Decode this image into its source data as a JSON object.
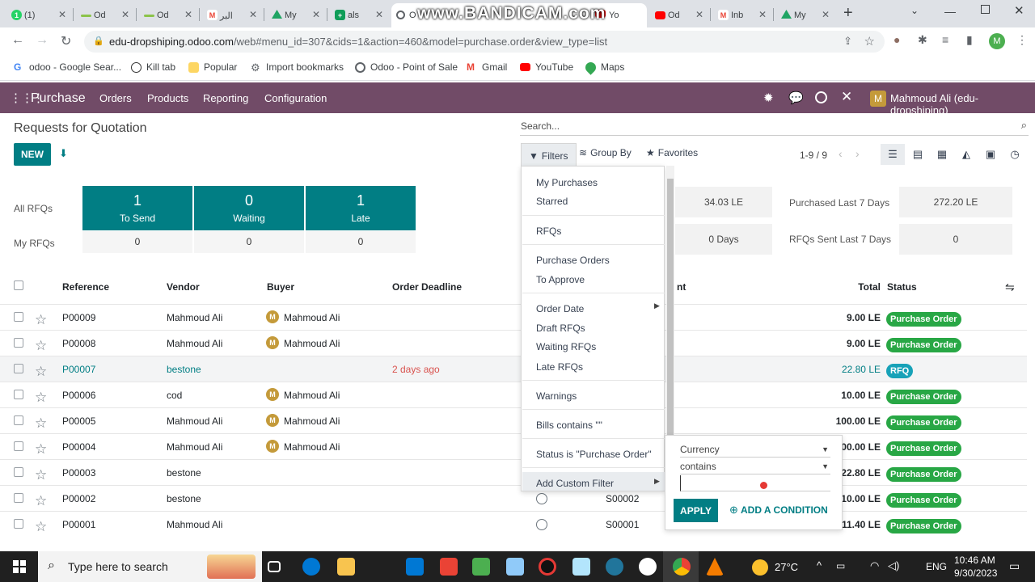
{
  "browser": {
    "tabs": [
      {
        "label": "(1)",
        "icon": "whatsapp-icon",
        "color": "#25d366"
      },
      {
        "label": "Od",
        "icon": "odoo-icon",
        "color": "#8bc34a"
      },
      {
        "label": "Od",
        "icon": "odoo-icon",
        "color": "#8bc34a"
      },
      {
        "label": "البر",
        "icon": "gmail-icon",
        "color": "#ea4335"
      },
      {
        "label": "My",
        "icon": "drive-icon",
        "color": "#1fa463"
      },
      {
        "label": "als",
        "icon": "sheets-icon",
        "color": "#0f9d58"
      },
      {
        "label": "O",
        "icon": "odoo-circle-icon",
        "color": "#5f6368"
      },
      {
        "label": "Yo",
        "icon": "youtube-icon",
        "color": "#ff0000"
      },
      {
        "label": "Od",
        "icon": "youtube-icon",
        "color": "#ff0000"
      },
      {
        "label": "Inb",
        "icon": "gmail-icon",
        "color": "#ea4335"
      },
      {
        "label": "My",
        "icon": "drive-icon",
        "color": "#1fa463"
      }
    ],
    "url_host": "edu-dropshiping.odoo.com",
    "url_path": "/web#menu_id=307&cids=1&action=460&model=purchase.order&view_type=list",
    "profile_initial": "M",
    "bookmarks": [
      {
        "label": "odoo - Google Sear...",
        "icon": "google-icon"
      },
      {
        "label": "Kill tab",
        "icon": "kill-tab-icon"
      },
      {
        "label": "Popular",
        "icon": "folder-icon"
      },
      {
        "label": "Import bookmarks",
        "icon": "gear-icon"
      },
      {
        "label": "Odoo - Point of Sale",
        "icon": "odoo-circle-icon"
      },
      {
        "label": "Gmail",
        "icon": "gmail-icon"
      },
      {
        "label": "YouTube",
        "icon": "youtube-icon"
      },
      {
        "label": "Maps",
        "icon": "maps-icon"
      }
    ]
  },
  "watermark": "www.BANDICAM.com",
  "app": {
    "name": "Purchase",
    "menu": [
      "Orders",
      "Products",
      "Reporting",
      "Configuration"
    ],
    "user": "Mahmoud Ali (edu-dropshiping)",
    "user_initial": "M",
    "brand_color": "#714b67",
    "accent_color": "#017e84"
  },
  "control": {
    "breadcrumb": "Requests for Quotation",
    "new_label": "NEW",
    "search_placeholder": "Search...",
    "filters_label": "Filters",
    "groupby_label": "Group By",
    "favorites_label": "Favorites",
    "pager": "1-9 / 9"
  },
  "dashboard": {
    "all_rfqs_label": "All RFQs",
    "my_rfqs_label": "My RFQs",
    "tiles": [
      {
        "count": "1",
        "label": "To Send",
        "mine": "0"
      },
      {
        "count": "0",
        "label": "Waiting",
        "mine": "0"
      },
      {
        "count": "1",
        "label": "Late",
        "mine": "0"
      }
    ],
    "stat1_value": "34.03 LE",
    "stat2_value": "0 Days",
    "purchased_label": "Purchased Last 7 Days",
    "purchased_value": "272.20 LE",
    "rfqs_sent_label": "RFQs Sent Last 7 Days",
    "rfqs_sent_value": "0"
  },
  "table": {
    "headers": {
      "reference": "Reference",
      "vendor": "Vendor",
      "buyer": "Buyer",
      "deadline": "Order Deadline",
      "amount_partial": "nt",
      "total": "Total",
      "status": "Status"
    },
    "rows": [
      {
        "ref": "P00009",
        "vendor": "Mahmoud Ali",
        "buyer": "Mahmoud Ali",
        "deadline": "",
        "source": "",
        "total": "9.00 LE",
        "status": "Purchase Order"
      },
      {
        "ref": "P00008",
        "vendor": "Mahmoud Ali",
        "buyer": "Mahmoud Ali",
        "deadline": "",
        "source": "",
        "total": "9.00 LE",
        "status": "Purchase Order"
      },
      {
        "ref": "P00007",
        "vendor": "bestone",
        "buyer": "",
        "deadline": "2 days ago",
        "source": "",
        "total": "22.80 LE",
        "status": "RFQ"
      },
      {
        "ref": "P00006",
        "vendor": "cod",
        "buyer": "Mahmoud Ali",
        "deadline": "",
        "source": "",
        "total": "10.00 LE",
        "status": "Purchase Order"
      },
      {
        "ref": "P00005",
        "vendor": "Mahmoud Ali",
        "buyer": "Mahmoud Ali",
        "deadline": "",
        "source": "",
        "total": "100.00 LE",
        "status": "Purchase Order"
      },
      {
        "ref": "P00004",
        "vendor": "Mahmoud Ali",
        "buyer": "Mahmoud Ali",
        "deadline": "",
        "source": "",
        "total": "00.00 LE",
        "status": "Purchase Order"
      },
      {
        "ref": "P00003",
        "vendor": "bestone",
        "buyer": "",
        "deadline": "",
        "source": "",
        "total": "22.80 LE",
        "status": "Purchase Order"
      },
      {
        "ref": "P00002",
        "vendor": "bestone",
        "buyer": "",
        "deadline": "",
        "source": "S00002",
        "total": "10.00 LE",
        "status": "Purchase Order"
      },
      {
        "ref": "P00001",
        "vendor": "Mahmoud Ali",
        "buyer": "",
        "deadline": "",
        "source": "S00001",
        "total": "11.40 LE",
        "status": "Purchase Order"
      }
    ]
  },
  "filters_menu": {
    "items": [
      "My Purchases",
      "Starred",
      "RFQs",
      "Purchase Orders",
      "To Approve",
      "Order Date",
      "Draft RFQs",
      "Waiting RFQs",
      "Late RFQs",
      "Warnings",
      "Bills contains \"\"",
      "Status is \"Purchase Order\"",
      "Add Custom Filter"
    ]
  },
  "custom_filter": {
    "field": "Currency",
    "operator": "contains",
    "value": "",
    "apply_label": "APPLY",
    "add_condition_label": "ADD A CONDITION"
  },
  "taskbar": {
    "search_placeholder": "Type here to search",
    "temperature": "27°C",
    "language": "ENG",
    "time": "10:46 AM",
    "date": "9/30/2023"
  }
}
